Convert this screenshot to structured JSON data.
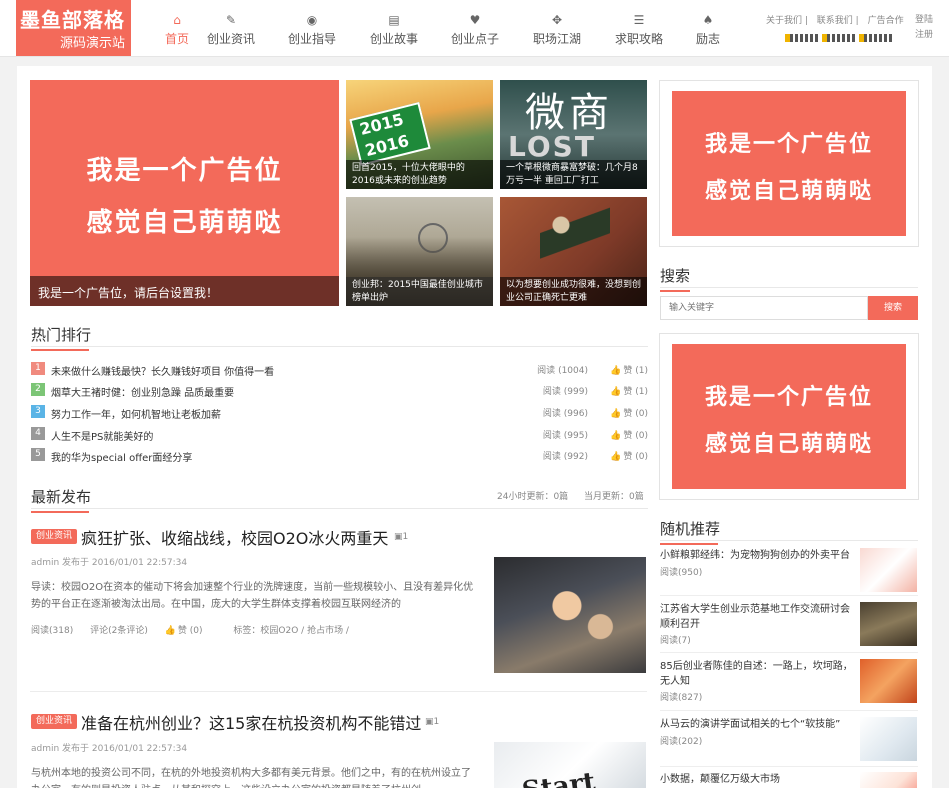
{
  "brand": {
    "line1": "墨鱼部落格",
    "line2": "源码演示站"
  },
  "nav": [
    {
      "label": "首页",
      "icon": "home-icon",
      "glyph": "⌂"
    },
    {
      "label": "创业资讯",
      "icon": "edit-icon",
      "glyph": "✎"
    },
    {
      "label": "创业指导",
      "icon": "eye-icon",
      "glyph": "◉"
    },
    {
      "label": "创业故事",
      "icon": "film-icon",
      "glyph": "▤"
    },
    {
      "label": "创业点子",
      "icon": "heart-icon",
      "glyph": "♥"
    },
    {
      "label": "职场江湖",
      "icon": "move-icon",
      "glyph": "✥"
    },
    {
      "label": "求职攻略",
      "icon": "list-icon",
      "glyph": "☰"
    },
    {
      "label": "励志",
      "icon": "spade-icon",
      "glyph": "♠"
    }
  ],
  "toplinks": [
    "关于我们",
    "联系我们",
    "广告合作"
  ],
  "account": {
    "login": "登陆",
    "register": "注册"
  },
  "hero": {
    "ad_line1": "我是一个广告位",
    "ad_line2": "感觉自己萌萌哒",
    "ad_caption": "我是一个广告位，请后台设置我！",
    "tiles": [
      {
        "caption": "回首2015，十位大佬眼中的2016或未来的创业趋势",
        "sign_top": "2015",
        "sign_bottom": "2016"
      },
      {
        "caption": "一个草根微商暴富梦破：几个月8万亏一半 重回工厂打工",
        "overlay": "微商",
        "overlay2": "LOST"
      },
      {
        "caption": "创业邦：2015中国最佳创业城市榜单出炉"
      },
      {
        "caption": "以为想要创业成功很难，没想到创业公司正确死亡更难"
      }
    ]
  },
  "hot": {
    "title": "热门排行",
    "read_prefix": "阅读",
    "like_prefix": "赞",
    "items": [
      {
        "num": "1",
        "title": "未来做什么赚钱最快？长久赚钱好项目 你值得一看",
        "reads": "(1004)",
        "likes": "(1)",
        "color": "#f08a7e"
      },
      {
        "num": "2",
        "title": "烟草大王褚时健：创业别急躁 品质最重要",
        "reads": "(999)",
        "likes": "(1)",
        "color": "#7cc576"
      },
      {
        "num": "3",
        "title": "努力工作一年，如何机智地让老板加薪",
        "reads": "(996)",
        "likes": "(0)",
        "color": "#5ab4e6"
      },
      {
        "num": "4",
        "title": "人生不是PS就能美好的",
        "reads": "(995)",
        "likes": "(0)",
        "color": "#999999"
      },
      {
        "num": "5",
        "title": "我的华为special offer面经分享",
        "reads": "(992)",
        "likes": "(0)",
        "color": "#999999"
      }
    ]
  },
  "latest": {
    "title": "最新发布",
    "updates_24h": "24小时更新：0篇",
    "updates_month": "当月更新：0篇",
    "posts": [
      {
        "tag": "创业资讯",
        "title": "疯狂扩张、收缩战线，校园O2O冰火两重天",
        "img_count": "1",
        "author": "admin 发布于 2016/01/01 22:57:34",
        "excerpt": "导读：校园O2O在资本的催动下将会加速整个行业的洗牌速度，当前一些规模较小、且没有差异化优势的平台正在逐渐被淘汰出局。在中国，庞大的大学生群体支撑着校园互联网经济的",
        "reads": "阅读(318)",
        "comments": "评论(2条评论)",
        "likes": "赞 (0)",
        "tags": "标签：校园O2O / 抢占市场 /"
      },
      {
        "tag": "创业资讯",
        "title": "准备在杭州创业？这15家在杭投资机构不能错过",
        "img_count": "1",
        "author": "admin 发布于 2016/01/01 22:57:34",
        "excerpt": "与杭州本地的投资公司不同，在杭的外地投资机构大多都有美元背景。他们之中，有的在杭州设立了办公室，有的则是投资人驻点，从其和探究上，这些设立办公室的投资都是随着了杭州创",
        "image_text": "Start"
      }
    ]
  },
  "sidebar": {
    "ad_line1": "我是一个广告位",
    "ad_line2": "感觉自己萌萌哒",
    "search_title": "搜索",
    "search_placeholder": "输入关键字",
    "search_button": "搜索",
    "random_title": "随机推荐",
    "random": [
      {
        "title": "小鲜粮郭经纬：为宠物狗狗创办的外卖平台",
        "reads": "阅读(950)"
      },
      {
        "title": "江苏省大学生创业示范基地工作交流研讨会顺利召开",
        "reads": "阅读(7)"
      },
      {
        "title": "85后创业者陈佳的自述：一路上，坎坷路，无人知",
        "reads": "阅读(827)"
      },
      {
        "title": "从马云的演讲学面试相关的七个“软技能”",
        "reads": "阅读(202)"
      },
      {
        "title": "小数据，颠覆亿万级大市场",
        "reads": ""
      }
    ]
  },
  "colors": {
    "accent": "#f36a5a",
    "border": "#e3e3e3"
  }
}
